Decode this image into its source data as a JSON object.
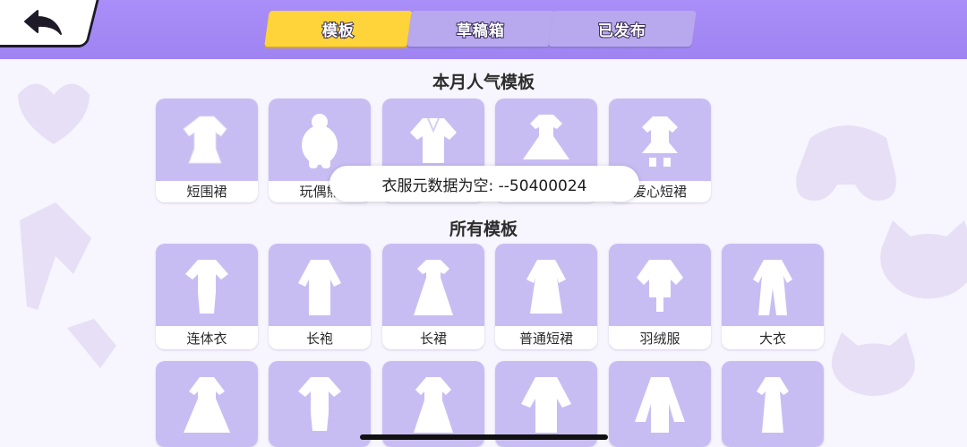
{
  "tabs": [
    {
      "label": "模板",
      "active": true
    },
    {
      "label": "草稿箱",
      "active": false
    },
    {
      "label": "已发布",
      "active": false
    }
  ],
  "popular": {
    "title": "本月人气模板",
    "items": [
      {
        "label": "短围裙",
        "icon": "apron-dress-icon"
      },
      {
        "label": "玩偶熊",
        "icon": "teddy-bear-suit-icon"
      },
      {
        "label": "",
        "icon": "sailor-top-icon"
      },
      {
        "label": "",
        "icon": "puff-dress-icon"
      },
      {
        "label": "爱心短裙",
        "icon": "heart-skirt-icon"
      }
    ]
  },
  "all": {
    "title": "所有模板",
    "items": [
      {
        "label": "连体衣",
        "icon": "jumpsuit-icon"
      },
      {
        "label": "长袍",
        "icon": "long-robe-icon"
      },
      {
        "label": "长裙",
        "icon": "long-skirt-icon"
      },
      {
        "label": "普通短裙",
        "icon": "short-dress-icon"
      },
      {
        "label": "羽绒服",
        "icon": "down-jacket-icon"
      },
      {
        "label": "大衣",
        "icon": "overcoat-icon"
      }
    ],
    "row3_icons": [
      "gown-icon",
      "bodysuit-icon",
      "layered-dress-icon",
      "kimono-icon",
      "cape-outfit-icon",
      "slit-dress-icon"
    ]
  },
  "toast": "衣服元数据为空: --50400024",
  "colors": {
    "header": "#a38af6",
    "active_tab": "#ffd43a",
    "inactive_tab": "#b8a8ee",
    "thumb_bg": "#c8bdf3"
  }
}
